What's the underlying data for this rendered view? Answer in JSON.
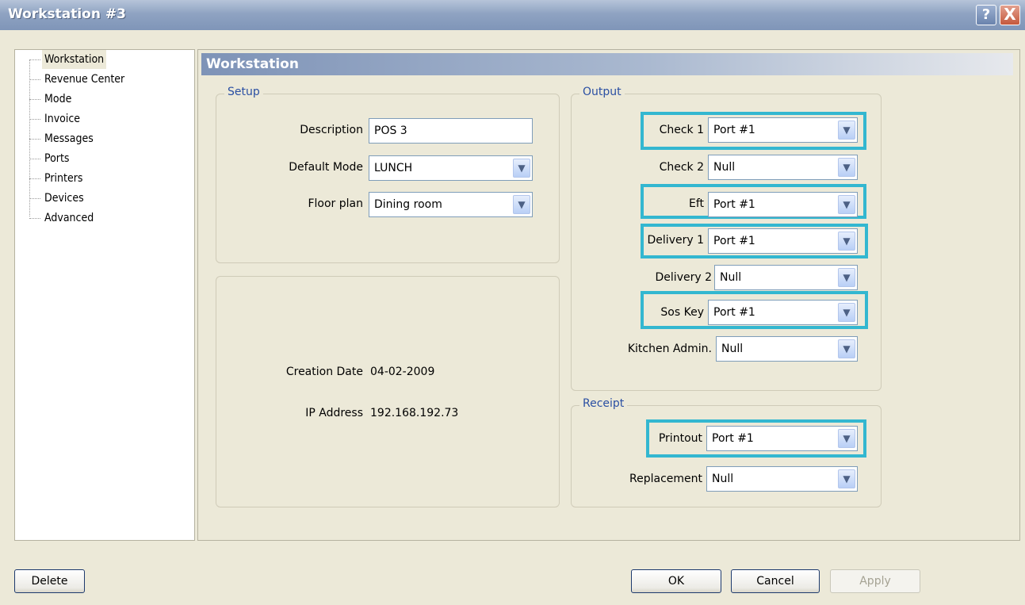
{
  "window": {
    "title": "Workstation #3",
    "help_label": "?",
    "close_label": "X"
  },
  "tree": {
    "items": [
      "Workstation",
      "Revenue Center",
      "Mode",
      "Invoice",
      "Messages",
      "Ports",
      "Printers",
      "Devices",
      "Advanced"
    ],
    "selected": "Workstation"
  },
  "pane": {
    "header": "Workstation"
  },
  "setup": {
    "legend": "Setup",
    "description_label": "Description",
    "description_value": "POS 3",
    "default_mode_label": "Default Mode",
    "default_mode_value": "LUNCH",
    "floor_plan_label": "Floor plan",
    "floor_plan_value": "Dining room"
  },
  "info": {
    "creation_date_label": "Creation Date",
    "creation_date_value": "04-02-2009",
    "ip_address_label": "IP Address",
    "ip_address_value": "192.168.192.73"
  },
  "output": {
    "legend": "Output",
    "rows": [
      {
        "label": "Check 1",
        "value": "Port #1"
      },
      {
        "label": "Check 2",
        "value": "Null"
      },
      {
        "label": "Eft",
        "value": "Port #1"
      },
      {
        "label": "Delivery 1",
        "value": "Port #1"
      },
      {
        "label": "Delivery 2",
        "value": "Null"
      },
      {
        "label": "Sos Key",
        "value": "Port #1"
      },
      {
        "label": "Kitchen Admin.",
        "value": "Null"
      }
    ]
  },
  "receipt": {
    "legend": "Receipt",
    "rows": [
      {
        "label": "Printout",
        "value": "Port #1"
      },
      {
        "label": "Replacement",
        "value": "Null"
      }
    ]
  },
  "buttons": {
    "delete": "Delete",
    "ok": "OK",
    "cancel": "Cancel",
    "apply": "Apply"
  },
  "colors": {
    "highlight": "#33b7d0",
    "title_bar": "#8fa3c2",
    "legend_text": "#2a4fa3"
  }
}
